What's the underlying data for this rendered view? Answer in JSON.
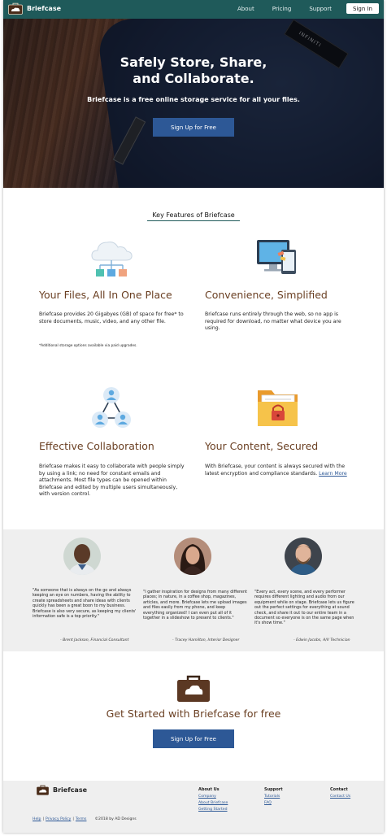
{
  "nav": {
    "brand": "Briefcase",
    "links": [
      "About",
      "Pricing",
      "Support"
    ],
    "signin": "Sign In"
  },
  "hero": {
    "title_line1": "Safely Store, Share,",
    "title_line2": "and Collaborate.",
    "subtitle": "Briefcase is a free online storage service for all your files.",
    "button": "Sign Up for Free",
    "tag_text": "INFINITI"
  },
  "features": {
    "heading": "Key Features of Briefcase",
    "items": [
      {
        "title": "Your Files, All In One Place",
        "text": "Briefcase provides 20 Gigabyes (GB) of space for free* to store documents, music, video, and any other file.",
        "note": "*Additional storage options available via paid upgrades."
      },
      {
        "title": "Convenience, Simplified",
        "text": "Briefcase runs entirely through the web, so no app is required for download, no matter what device you are using."
      },
      {
        "title": "Effective Collaboration",
        "text": "Briefcase makes it easy to collaborate with people simply by using a link; no need for constant emails and attachments. Most file types can be opened within Briefcase and edited by multiple users simultaneously, with version control."
      },
      {
        "title": "Your Content, Secured",
        "text": "With Briefcase, your content is always secured with the latest encryption and compliance standards.",
        "link": "Learn More"
      }
    ]
  },
  "testimonials": [
    {
      "quote": "\"As someone that is always on the go and always keeping an eye on numbers, having the ability to create spreadsheets and share ideas with clients quickly has been a great boon to my business. Briefcase is also very secure, as keeping my clients' information safe is a top priority.\"",
      "author": "- Brent Jackson, Financial Consultant"
    },
    {
      "quote": "\"I gather inspiration for designs from many different places; in nature, in a coffee shop, magazines, articles, and more. Briefcase lets me upload images and files easily from my phone, and keep everything organized! I can even put all of it together in a slideshow to present to clients.\"",
      "author": "- Tracey Hamilton, Interior Designer"
    },
    {
      "quote": "\"Every act, every scene, and every performer requires different lighting and audio from our equipment while on stage. Briefcase lets us figure out the perfect settings for everything at sound check, and share it out to our entire team in a document so everyone is on the same page when it's show time.\"",
      "author": "- Edwin Jacobs, A/V Technician"
    }
  ],
  "cta": {
    "title": "Get Started with Briefcase for free",
    "button": "Sign Up for Free"
  },
  "footer": {
    "brand": "Briefcase",
    "columns": [
      {
        "heading": "About Us",
        "links": [
          "Company",
          "About Briefcase",
          "Getting Started"
        ]
      },
      {
        "heading": "Support",
        "links": [
          "Tutorials",
          "FAQ"
        ]
      },
      {
        "heading": "Contact",
        "links": [
          "Contact Us"
        ]
      }
    ],
    "bottom_links": [
      "Help",
      "Privacy Policy",
      "Terms"
    ],
    "copyright": "©2018 by AD Designs"
  },
  "colors": {
    "nav_bg": "#1f5a5a",
    "button_bg": "#2d5896",
    "title_brown": "#6a3f22",
    "band_gray": "#efefef"
  },
  "icons": [
    "briefcase-logo-icon",
    "cloud-network-icon",
    "devices-icon",
    "collaboration-icon",
    "secure-folder-icon",
    "briefcase-icon"
  ]
}
